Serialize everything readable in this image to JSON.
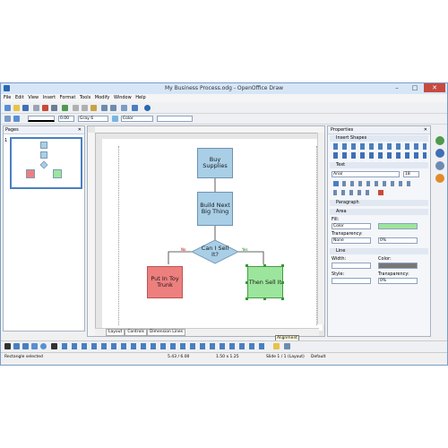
{
  "window": {
    "title": "My Business Process.odg - OpenOffice Draw"
  },
  "menu": [
    "File",
    "Edit",
    "View",
    "Insert",
    "Format",
    "Tools",
    "Modify",
    "Window",
    "Help"
  ],
  "toolbar": {
    "zoom": "0.00",
    "line_color": "Gray 6",
    "area": "Color"
  },
  "pages_panel": {
    "title": "Pages",
    "page_number": "1"
  },
  "tabs": [
    "Layout",
    "Controls",
    "Dimension Lines"
  ],
  "flowchart": {
    "n1": "Buy Supplies",
    "n2": "Build Next Big Thing",
    "n3": "Can I Sell It?",
    "n4": "Put In Toy Trunk",
    "n5": "Then Sell It",
    "no_label": "No",
    "yes_label": "Yes"
  },
  "properties": {
    "title": "Properties",
    "insert_shapes": "Insert Shapes",
    "text": "Text",
    "font": "Arial",
    "size": "18",
    "paragraph": "Paragraph",
    "area": "Area",
    "fill_label": "Fill:",
    "fill_value": "Color",
    "transparency_label": "Transparency:",
    "transparency_value": "None",
    "transparency_pct": "0%",
    "line": "Line",
    "width_label": "Width:",
    "color_label": "Color:",
    "style_label": "Style:",
    "line_transparency_label": "Transparency:",
    "line_transparency_value": "0%"
  },
  "tooltip": "Alignment",
  "status": {
    "selection": "Rectangle selected",
    "position": "5.43 / 6.00",
    "size": "1.50 x 1.25",
    "slide": "Slide 1 / 1 (Layout)",
    "style": "Default"
  },
  "colors": {
    "box": "#a9cfe6",
    "red": "#ee7f7f",
    "green": "#9ce59c",
    "close": "#c74a3f"
  }
}
